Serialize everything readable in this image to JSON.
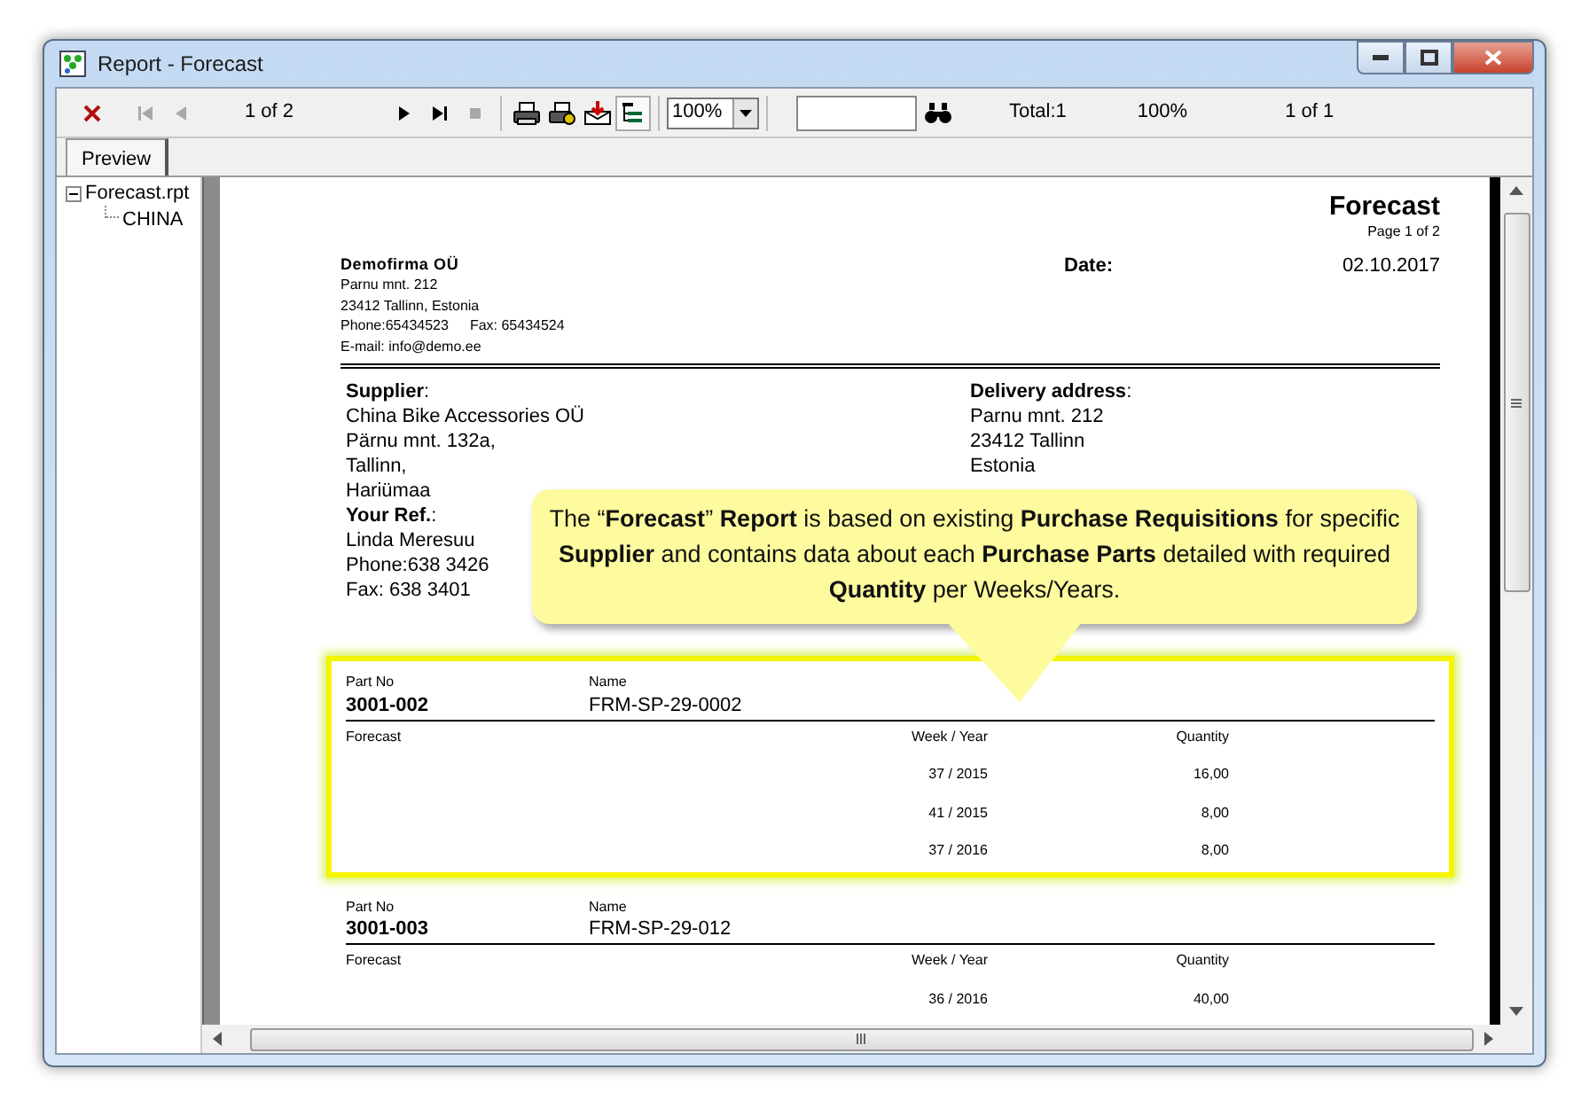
{
  "window": {
    "title": "Report - Forecast"
  },
  "toolbar": {
    "nav_buttons": [
      {
        "disabled": false
      },
      {
        "disabled": true
      },
      {
        "disabled": true
      },
      {
        "disabled": false
      },
      {
        "disabled": false
      },
      {
        "disabled": true
      }
    ],
    "page_label": "1 of 2",
    "tree_toggle": {
      "pressed": true
    },
    "zoom": "100%",
    "total": "Total:1",
    "percent": "100%",
    "count": "1 of 1"
  },
  "tabs": [
    {
      "label": "Preview",
      "selected": true
    }
  ],
  "tree": [
    {
      "label": "Forecast.rpt",
      "expanded": true,
      "children": [
        {
          "label": "CHINA"
        }
      ]
    }
  ],
  "report": {
    "title": "Forecast",
    "page": "Page 1 of 2",
    "company": {
      "name": "Demofirma OÜ",
      "lines": [
        "Parnu mnt. 212",
        "23412 Tallinn, Estonia"
      ],
      "phone": "Phone:65434523",
      "fax": "Fax:  65434524",
      "email": "E-mail: info@demo.ee"
    },
    "date_label": "Date:",
    "date": "02.10.2017",
    "supplier": {
      "label": "**Supplier**:",
      "lines": [
        "China Bike Accessories OÜ",
        "Pärnu mnt. 132a,",
        "Tallinn,",
        "Hariümaa"
      ],
      "ref_label": "**Your Ref.**:",
      "ref_lines": [
        "Linda Meresuu",
        "Phone:638 3426",
        "Fax: 638 3401"
      ]
    },
    "delivery": {
      "label": "**Delivery address**:",
      "lines": [
        "Parnu mnt. 212",
        "23412 Tallinn",
        "Estonia"
      ]
    },
    "parts": [
      {
        "highlighted": true,
        "part_no_label": "Part No",
        "part_no": "3001-002",
        "name_label": "Name",
        "name": "FRM-SP-29-0002",
        "forecast_label": "Forecast",
        "week_label": "Week / Year",
        "qty_label": "Quantity",
        "rows": [
          {
            "week": "37 / 2015",
            "quantity": "16,00"
          },
          {
            "week": "41 / 2015",
            "quantity": "8,00"
          },
          {
            "week": "37 / 2016",
            "quantity": "8,00"
          }
        ]
      },
      {
        "highlighted": false,
        "part_no_label": "Part No",
        "part_no": "3001-003",
        "name_label": "Name",
        "name": "FRM-SP-29-012",
        "forecast_label": "Forecast",
        "week_label": "Week / Year",
        "qty_label": "Quantity",
        "rows": [
          {
            "week": "36 / 2016",
            "quantity": "40,00"
          }
        ]
      }
    ]
  },
  "callout": {
    "text": "The “**Forecast**” **Report** is based on existing **Purchase Requisitions** for specific **Supplier** and contains data about each **Purchase Parts** detailed with required **Quantity** per Weeks/Years."
  }
}
